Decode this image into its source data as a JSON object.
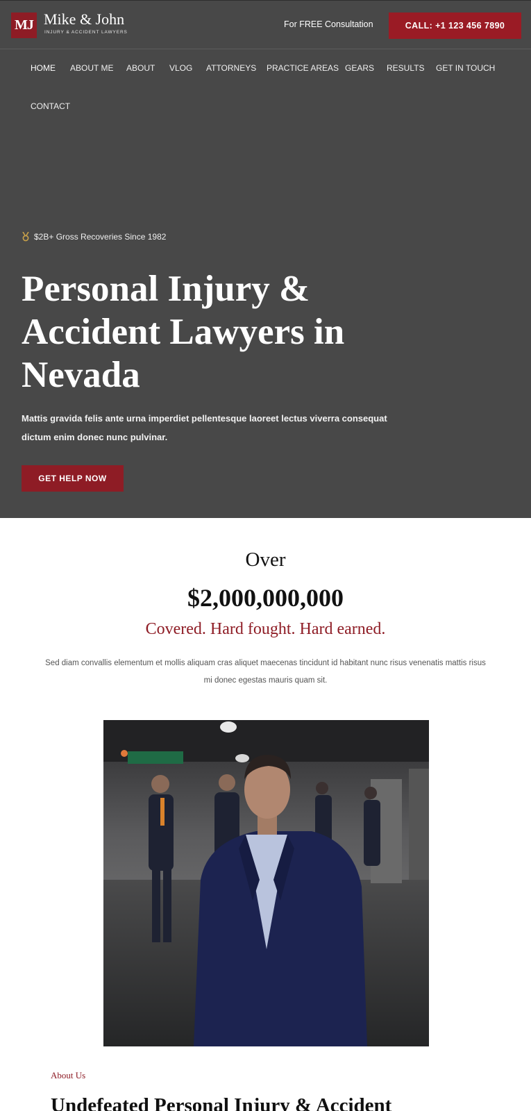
{
  "header": {
    "logo_mark": "MJ",
    "logo_title": "Mike & John",
    "logo_subtitle": "INJURY & ACCIDENT LAWYERS",
    "consult_link": "For FREE Consultation",
    "call_button": "CALL: +1 123 456 7890"
  },
  "nav": {
    "items": [
      "HOME",
      "ABOUT ME",
      "ABOUT",
      "VLOG",
      "ATTORNEYS",
      "PRACTICE AREAS",
      "GEARS",
      "RESULTS",
      "GET IN TOUCH",
      "CONTACT"
    ],
    "active": "HOME"
  },
  "hero": {
    "badge_icon": "medal-icon",
    "badge_text": "$2B+ Gross Recoveries Since 1982",
    "title": "Personal Injury & Accident Lawyers in Nevada",
    "text": "Mattis gravida felis ante urna imperdiet pellentesque laoreet lectus viverra consequat dictum enim donec nunc pulvinar.",
    "cta": "GET HELP NOW"
  },
  "stats": {
    "over": "Over",
    "amount": "$2,000,000,000",
    "tagline": "Covered. Hard fought. Hard earned.",
    "text": "Sed diam convallis elementum et mollis aliquam cras aliquet maecenas tincidunt id habitant nunc risus venenatis mattis risus mi donec egestas mauris quam sit."
  },
  "about": {
    "label": "About Us",
    "heading": "Undefeated Personal Injury & Accident"
  },
  "colors": {
    "brand_red": "#8e1c25",
    "hero_bg": "#484848",
    "gold": "#c9a24a"
  }
}
